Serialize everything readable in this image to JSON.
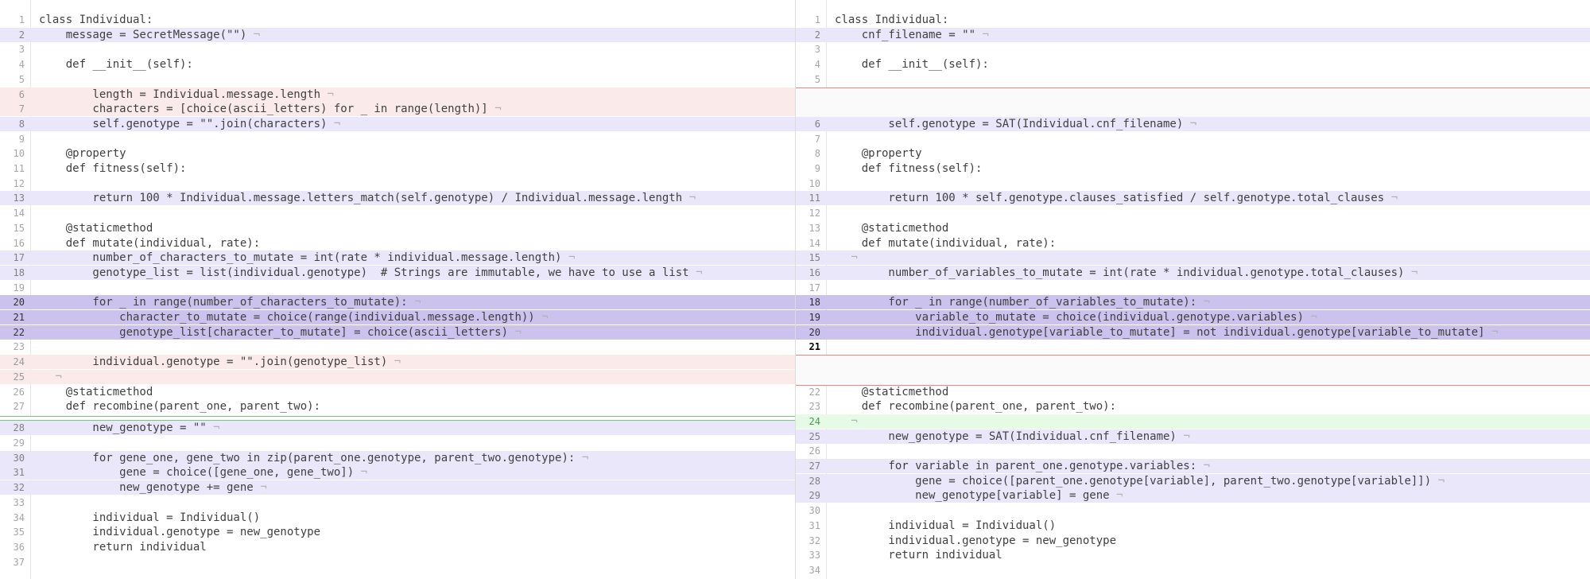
{
  "colors": {
    "changed_line": "#ebe7fb",
    "deleted_line": "#fbeaea",
    "added_line": "#e6fbe6",
    "modified_block": "#cbc3ee",
    "token_highlight": "#c8bdf0"
  },
  "pilcrow": "¬",
  "left": {
    "lines": [
      {
        "n": "1",
        "t": "class Individual:"
      },
      {
        "n": "2",
        "t": "    message = SecretMessage(\"\")",
        "k": "chg"
      },
      {
        "n": "3",
        "t": ""
      },
      {
        "n": "4",
        "t": "    def __init__(self):"
      },
      {
        "n": "5",
        "t": ""
      },
      {
        "n": "6",
        "t": "        length = Individual.message.length",
        "k": "del"
      },
      {
        "n": "7",
        "t": "        characters = [choice(ascii_letters) for _ in range(length)]",
        "k": "del"
      },
      {
        "n": "8",
        "t": "        self.genotype = \"\".join(characters)",
        "k": "chg"
      },
      {
        "n": "9",
        "t": ""
      },
      {
        "n": "10",
        "t": "    @property"
      },
      {
        "n": "11",
        "t": "    def fitness(self):"
      },
      {
        "n": "12",
        "t": ""
      },
      {
        "n": "13",
        "t": "        return 100 * Individual.message.letters_match(self.genotype) / Individual.message.length",
        "k": "chg"
      },
      {
        "n": "14",
        "t": ""
      },
      {
        "n": "15",
        "t": "    @staticmethod"
      },
      {
        "n": "16",
        "t": "    def mutate(individual, rate):"
      },
      {
        "n": "17",
        "t": "        number_of_characters_to_mutate = int(rate * individual.message.length)",
        "k": "chg"
      },
      {
        "n": "18",
        "t": "        genotype_list = list(individual.genotype)  # Strings are immutable, we have to use a list",
        "k": "chg"
      },
      {
        "n": "19",
        "t": ""
      },
      {
        "n": "20",
        "t": "        for _ in range(number_of_characters_to_mutate):",
        "k": "mod"
      },
      {
        "n": "21",
        "t": "            character_to_mutate = choice(range(individual.message.length))",
        "k": "mod"
      },
      {
        "n": "22",
        "t": "            genotype_list[character_to_mutate] = choice(ascii_letters)",
        "k": "mod"
      },
      {
        "n": "23",
        "t": ""
      },
      {
        "n": "24",
        "t": "        individual.genotype = \"\".join(genotype_list)",
        "k": "del"
      },
      {
        "n": "25",
        "t": "",
        "k": "del"
      },
      {
        "n": "26",
        "t": "    @staticmethod"
      },
      {
        "n": "27",
        "t": "    def recombine(parent_one, parent_two):"
      },
      {
        "n": "",
        "t": "",
        "k": "gapadd"
      },
      {
        "n": "28",
        "t": "        new_genotype = \"\"",
        "k": "chg"
      },
      {
        "n": "29",
        "t": ""
      },
      {
        "n": "30",
        "t": "        for gene_one, gene_two in zip(parent_one.genotype, parent_two.genotype):",
        "k": "chg"
      },
      {
        "n": "31",
        "t": "            gene = choice([gene_one, gene_two])",
        "k": "chg"
      },
      {
        "n": "32",
        "t": "            new_genotype += gene",
        "k": "chg"
      },
      {
        "n": "33",
        "t": ""
      },
      {
        "n": "34",
        "t": "        individual = Individual()"
      },
      {
        "n": "35",
        "t": "        individual.genotype = new_genotype"
      },
      {
        "n": "36",
        "t": "        return individual"
      },
      {
        "n": "37",
        "t": ""
      }
    ]
  },
  "right": {
    "lines": [
      {
        "n": "1",
        "t": "class Individual:"
      },
      {
        "n": "2",
        "t": "    cnf_filename = \"\"",
        "k": "chg"
      },
      {
        "n": "3",
        "t": ""
      },
      {
        "n": "4",
        "t": "    def __init__(self):"
      },
      {
        "n": "5",
        "t": ""
      },
      {
        "n": "",
        "t": "",
        "k": "gapdel2"
      },
      {
        "n": "6",
        "t": "        self.genotype = SAT(Individual.cnf_filename)",
        "k": "chg"
      },
      {
        "n": "7",
        "t": ""
      },
      {
        "n": "8",
        "t": "    @property"
      },
      {
        "n": "9",
        "t": "    def fitness(self):"
      },
      {
        "n": "10",
        "t": ""
      },
      {
        "n": "11",
        "t": "        return 100 * self.genotype.clauses_satisfied / self.genotype.total_clauses",
        "k": "chg"
      },
      {
        "n": "12",
        "t": ""
      },
      {
        "n": "13",
        "t": "    @staticmethod"
      },
      {
        "n": "14",
        "t": "    def mutate(individual, rate):"
      },
      {
        "n": "15",
        "t": "",
        "k": "chg"
      },
      {
        "n": "16",
        "t": "        number_of_variables_to_mutate = int(rate * individual.genotype.total_clauses)",
        "k": "chg"
      },
      {
        "n": "17",
        "t": ""
      },
      {
        "n": "18",
        "t": "        for _ in range(number_of_variables_to_mutate):",
        "k": "mod"
      },
      {
        "n": "19",
        "t": "            variable_to_mutate = choice(individual.genotype.variables)",
        "k": "mod"
      },
      {
        "n": "20",
        "t": "            individual.genotype[variable_to_mutate] = not individual.genotype[variable_to_mutate]",
        "k": "mod"
      },
      {
        "n": "21",
        "t": "",
        "k": "cur"
      },
      {
        "n": "",
        "t": "",
        "k": "gapdel2"
      },
      {
        "n": "22",
        "t": "    @staticmethod"
      },
      {
        "n": "23",
        "t": "    def recombine(parent_one, parent_two):"
      },
      {
        "n": "24",
        "t": "",
        "k": "add"
      },
      {
        "n": "25",
        "t": "        new_genotype = SAT(Individual.cnf_filename)",
        "k": "chg"
      },
      {
        "n": "26",
        "t": ""
      },
      {
        "n": "27",
        "t": "        for variable in parent_one.genotype.variables:",
        "k": "chg"
      },
      {
        "n": "28",
        "t": "            gene = choice([parent_one.genotype[variable], parent_two.genotype[variable]])",
        "k": "chg"
      },
      {
        "n": "29",
        "t": "            new_genotype[variable] = gene",
        "k": "chg"
      },
      {
        "n": "30",
        "t": ""
      },
      {
        "n": "31",
        "t": "        individual = Individual()"
      },
      {
        "n": "32",
        "t": "        individual.genotype = new_genotype"
      },
      {
        "n": "33",
        "t": "        return individual"
      },
      {
        "n": "34",
        "t": ""
      }
    ]
  }
}
